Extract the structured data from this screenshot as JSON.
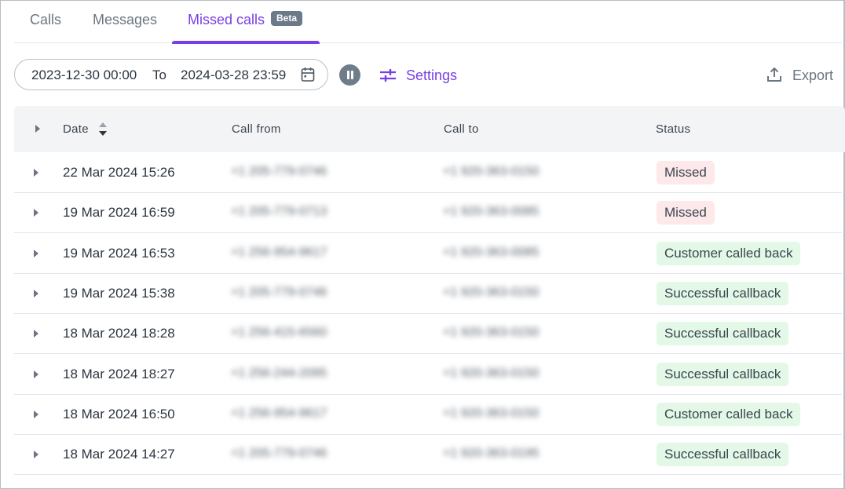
{
  "tabs": {
    "calls": "Calls",
    "messages": "Messages",
    "missed": "Missed calls",
    "badge": "Beta"
  },
  "toolbar": {
    "from": "2023-12-30 00:00",
    "to_label": "To",
    "to": "2024-03-28 23:59",
    "settings": "Settings",
    "export": "Export"
  },
  "table": {
    "headers": {
      "date": "Date",
      "from": "Call from",
      "to": "Call to",
      "status": "Status"
    },
    "rows": [
      {
        "date": "22 Mar 2024 15:26",
        "from": "+1 205-779-0746",
        "to": "+1 920-363-0150",
        "status": "Missed"
      },
      {
        "date": "19 Mar 2024 16:59",
        "from": "+1 205-779-0713",
        "to": "+1 920-363-0085",
        "status": "Missed"
      },
      {
        "date": "19 Mar 2024 16:53",
        "from": "+1 256-954-9617",
        "to": "+1 920-363-0085",
        "status": "Customer called back"
      },
      {
        "date": "19 Mar 2024 15:38",
        "from": "+1 205-779-0746",
        "to": "+1 920-363-0150",
        "status": "Successful callback"
      },
      {
        "date": "18 Mar 2024 18:28",
        "from": "+1 256-415-6560",
        "to": "+1 920-363-0150",
        "status": "Successful callback"
      },
      {
        "date": "18 Mar 2024 18:27",
        "from": "+1 256-244-2095",
        "to": "+1 920-363-0150",
        "status": "Successful callback"
      },
      {
        "date": "18 Mar 2024 16:50",
        "from": "+1 256-954-9617",
        "to": "+1 920-363-0150",
        "status": "Customer called back"
      },
      {
        "date": "18 Mar 2024 14:27",
        "from": "+1 205-779-0746",
        "to": "+1 920-363-0195",
        "status": "Successful callback"
      }
    ]
  },
  "colors": {
    "accent": "#7a3fe4",
    "missed_bg": "#fde8ea",
    "success_bg": "#e3f8e6"
  }
}
